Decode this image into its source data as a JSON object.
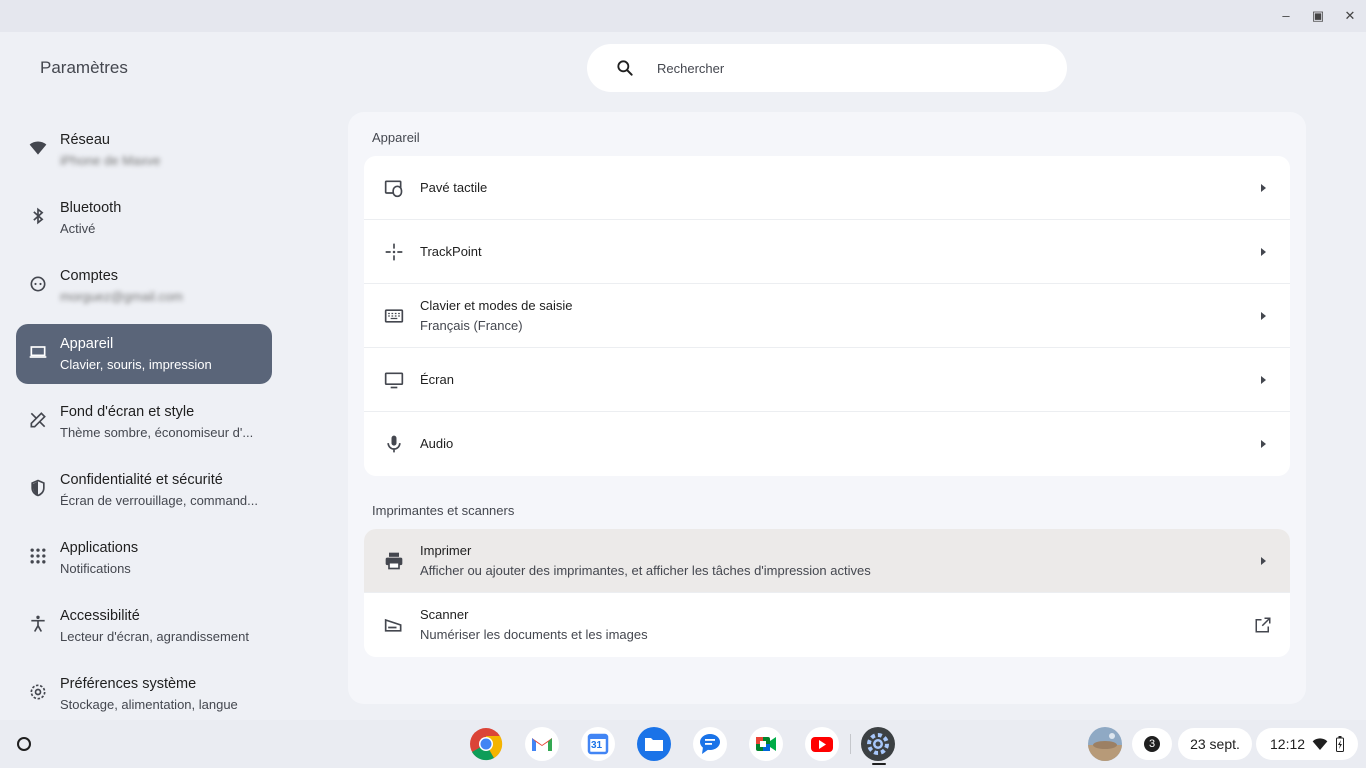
{
  "window": {
    "minimize": "–",
    "restore": "▣",
    "close": "✕"
  },
  "app_title": "Paramètres",
  "search": {
    "placeholder": "Rechercher"
  },
  "nav": [
    {
      "label": "Réseau",
      "sub": "iPhone de Maxve"
    },
    {
      "label": "Bluetooth",
      "sub": "Activé"
    },
    {
      "label": "Comptes",
      "sub": "morguez@gmail.com"
    },
    {
      "label": "Appareil",
      "sub": "Clavier, souris, impression"
    },
    {
      "label": "Fond d'écran et style",
      "sub": "Thème sombre, économiseur d'..."
    },
    {
      "label": "Confidentialité et sécurité",
      "sub": "Écran de verrouillage, command..."
    },
    {
      "label": "Applications",
      "sub": "Notifications"
    },
    {
      "label": "Accessibilité",
      "sub": "Lecteur d'écran, agrandissement"
    },
    {
      "label": "Préférences système",
      "sub": "Stockage, alimentation, langue"
    }
  ],
  "device_section": {
    "title": "Appareil",
    "rows": [
      {
        "label": "Pavé tactile",
        "sub": ""
      },
      {
        "label": "TrackPoint",
        "sub": ""
      },
      {
        "label": "Clavier et modes de saisie",
        "sub": "Français (France)"
      },
      {
        "label": "Écran",
        "sub": ""
      },
      {
        "label": "Audio",
        "sub": ""
      }
    ]
  },
  "printers_section": {
    "title": "Imprimantes et scanners",
    "rows": [
      {
        "label": "Imprimer",
        "sub": "Afficher ou ajouter des imprimantes, et afficher les tâches d'impression actives"
      },
      {
        "label": "Scanner",
        "sub": "Numériser les documents et les images"
      }
    ]
  },
  "shelf": {
    "apps": [
      "chrome-icon",
      "gmail-icon",
      "calendar-icon",
      "files-icon",
      "messages-icon",
      "meet-icon",
      "youtube-icon",
      "settings-icon"
    ],
    "calendar_day": "31",
    "notification_count": "3",
    "date": "23 sept.",
    "time": "12:12"
  },
  "colors": {
    "active_nav": "#5a6579",
    "accent": "#1a73e8"
  }
}
